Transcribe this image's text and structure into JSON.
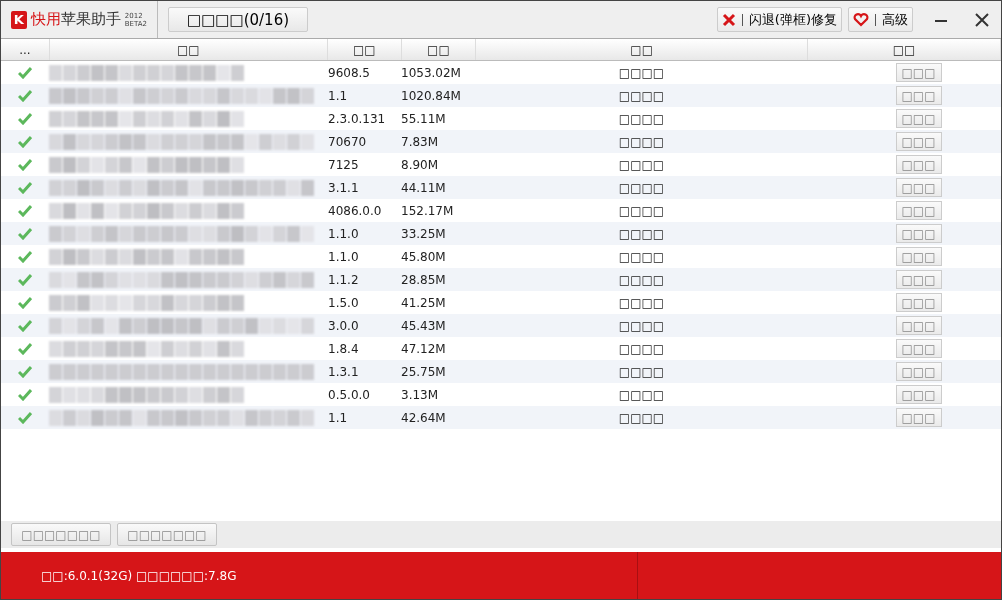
{
  "app": {
    "logo_letter": "K",
    "name_red": "快用",
    "name_rest": "苹果助手",
    "edition_year": "2012",
    "edition_tag": "BETA2"
  },
  "top_tab": {
    "label": "□□□□(0/16)"
  },
  "top_buttons": [
    {
      "kind": "repair",
      "label": "闪退(弹框)修复"
    },
    {
      "kind": "advanced",
      "label": "高级"
    }
  ],
  "table": {
    "columns": [
      "...",
      "□□",
      "□□",
      "□□",
      "□□",
      "□□"
    ],
    "rows": [
      {
        "checked": true,
        "version": "9608.5",
        "size": "1053.02M",
        "status": "□□□□",
        "action": "□□□"
      },
      {
        "checked": true,
        "version": "1.1",
        "size": "1020.84M",
        "status": "□□□□",
        "action": "□□□"
      },
      {
        "checked": true,
        "version": "2.3.0.131",
        "size": "55.11M",
        "status": "□□□□",
        "action": "□□□"
      },
      {
        "checked": true,
        "version": "70670",
        "size": "7.83M",
        "status": "□□□□",
        "action": "□□□"
      },
      {
        "checked": true,
        "version": "7125",
        "size": "8.90M",
        "status": "□□□□",
        "action": "□□□"
      },
      {
        "checked": true,
        "version": "3.1.1",
        "size": "44.11M",
        "status": "□□□□",
        "action": "□□□"
      },
      {
        "checked": true,
        "version": "4086.0.0",
        "size": "152.17M",
        "status": "□□□□",
        "action": "□□□"
      },
      {
        "checked": true,
        "version": "1.1.0",
        "size": "33.25M",
        "status": "□□□□",
        "action": "□□□"
      },
      {
        "checked": true,
        "version": "1.1.0",
        "size": "45.80M",
        "status": "□□□□",
        "action": "□□□"
      },
      {
        "checked": true,
        "version": "1.1.2",
        "size": "28.85M",
        "status": "□□□□",
        "action": "□□□"
      },
      {
        "checked": true,
        "version": "1.5.0",
        "size": "41.25M",
        "status": "□□□□",
        "action": "□□□"
      },
      {
        "checked": true,
        "version": "3.0.0",
        "size": "45.43M",
        "status": "□□□□",
        "action": "□□□"
      },
      {
        "checked": true,
        "version": "1.8.4",
        "size": "47.12M",
        "status": "□□□□",
        "action": "□□□"
      },
      {
        "checked": true,
        "version": "1.3.1",
        "size": "25.75M",
        "status": "□□□□",
        "action": "□□□"
      },
      {
        "checked": true,
        "version": "0.5.0.0",
        "size": "3.13M",
        "status": "□□□□",
        "action": "□□□"
      },
      {
        "checked": true,
        "version": "1.1",
        "size": "42.64M",
        "status": "□□□□",
        "action": "□□□"
      }
    ]
  },
  "bottom_buttons": [
    "□□□□□□□",
    "□□□□□□□"
  ],
  "status_bar": {
    "text": "□□:6.0.1(32G) □□□□□□:7.8G"
  }
}
